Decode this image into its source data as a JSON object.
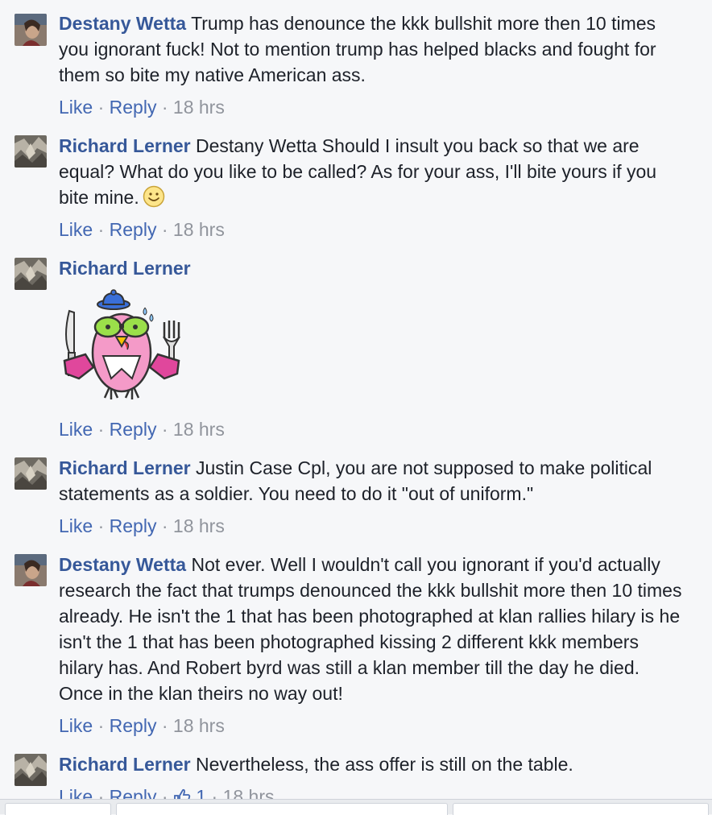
{
  "comments": [
    {
      "author": "Destany Wetta",
      "text": "Trump has denounce the kkk bullshit more then 10 times you ignorant fuck! Not to mention trump has helped blacks and fought for them so bite my native American ass.",
      "like_label": "Like",
      "reply_label": "Reply",
      "time": "18 hrs"
    },
    {
      "author": "Richard Lerner",
      "text": "Destany Wetta Should I insult you back so that we are equal? What do you like to be called? As for your ass, I'll bite yours if you bite mine.",
      "emoji": "smile-emoji",
      "like_label": "Like",
      "reply_label": "Reply",
      "time": "18 hrs"
    },
    {
      "author": "Richard Lerner",
      "sticker": "bird-with-knife-and-fork-sticker",
      "like_label": "Like",
      "reply_label": "Reply",
      "time": "18 hrs"
    },
    {
      "author": "Richard Lerner",
      "text": "Justin Case Cpl, you are not supposed to make political statements as a soldier. You need to do it \"out of uniform.\"",
      "like_label": "Like",
      "reply_label": "Reply",
      "time": "18 hrs"
    },
    {
      "author": "Destany Wetta",
      "text": "Not ever. Well I wouldn't call you ignorant if you'd actually research the fact that trumps denounced the kkk bullshit more then 10 times already. He isn't the 1 that has been photographed at klan rallies hilary is he isn't the 1 that has been photographed kissing 2 different kkk members hilary has. And Robert byrd was still a klan member till the day he died. Once in the klan theirs no way out!",
      "like_label": "Like",
      "reply_label": "Reply",
      "time": "18 hrs"
    },
    {
      "author": "Richard Lerner",
      "text": "Nevertheless, the ass offer is still on the table.",
      "like_label": "Like",
      "reply_label": "Reply",
      "like_count": "1",
      "time": "18 hrs"
    }
  ],
  "colors": {
    "author": "#365899",
    "action_link": "#4267b2",
    "meta": "#90949c",
    "background": "#f6f7f9"
  }
}
